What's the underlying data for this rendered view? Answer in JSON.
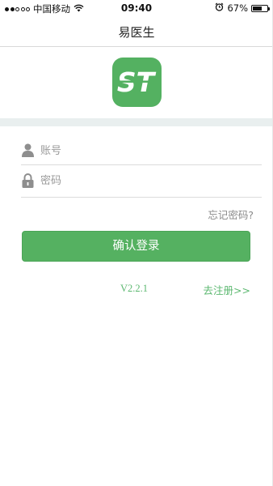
{
  "status_bar": {
    "carrier": "中国移动",
    "time": "09:40",
    "battery_percent_text": "67%",
    "battery_level": 0.67,
    "signal_bars_filled": 2,
    "signal_bars_total": 5,
    "icons": [
      "wifi-icon",
      "alarm-icon",
      "battery-icon"
    ]
  },
  "nav": {
    "title": "易医生"
  },
  "logo": {
    "text": "ST",
    "color": "#54b161"
  },
  "form": {
    "account": {
      "placeholder": "账号",
      "value": "",
      "icon": "user-icon"
    },
    "password": {
      "placeholder": "密码",
      "value": "",
      "icon": "lock-icon"
    },
    "forgot_label": "忘记密码?",
    "login_label": "确认登录"
  },
  "footer": {
    "version": "V2.2.1",
    "register_label": "去注册>>"
  },
  "colors": {
    "accent": "#55b161",
    "link": "#5cb870",
    "band": "#e9efef"
  }
}
